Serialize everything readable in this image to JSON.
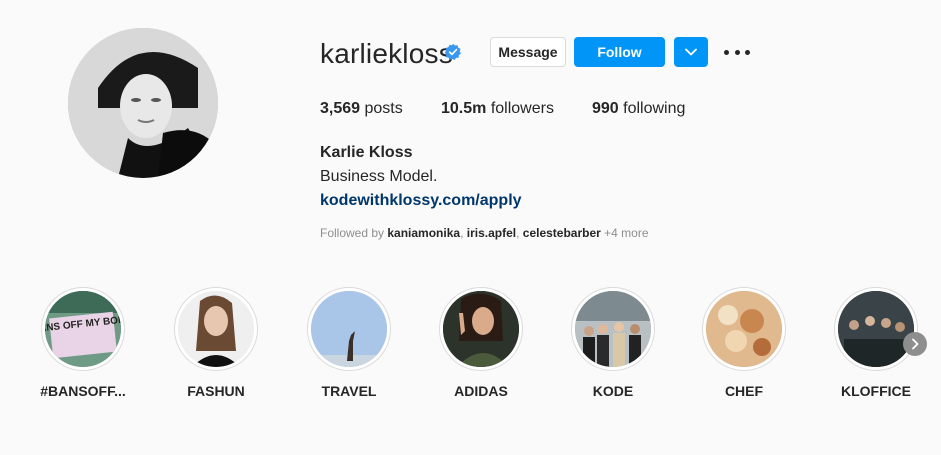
{
  "profile": {
    "username": "karliekloss",
    "message_label": "Message",
    "follow_label": "Follow",
    "stats": {
      "posts_count": "3,569",
      "posts_label": " posts",
      "followers_count": "10.5m",
      "followers_label": " followers",
      "following_count": "990",
      "following_label": " following"
    },
    "full_name": "Karlie Kloss",
    "bio": "Business Model.",
    "link": "kodewithklossy.com/apply",
    "followed_by": {
      "prefix": "Followed by ",
      "users": [
        "kaniamonika",
        "iris.apfel",
        "celestebarber"
      ],
      "more": " +4 more"
    }
  },
  "highlights": [
    {
      "label": "#BANSOFF...",
      "image_text": "BANS OFF MY BODY"
    },
    {
      "label": "FASHUN"
    },
    {
      "label": "TRAVEL"
    },
    {
      "label": "ADIDAS"
    },
    {
      "label": "KODE"
    },
    {
      "label": "CHEF"
    },
    {
      "label": "KLOFFICE"
    }
  ],
  "colors": {
    "accent": "#0095f6",
    "link": "#00376b",
    "muted": "#8e8e8e",
    "background": "#fafafa"
  },
  "icons": [
    "verified-badge-icon",
    "chevron-down-icon",
    "more-options-icon",
    "chevron-right-icon"
  ]
}
